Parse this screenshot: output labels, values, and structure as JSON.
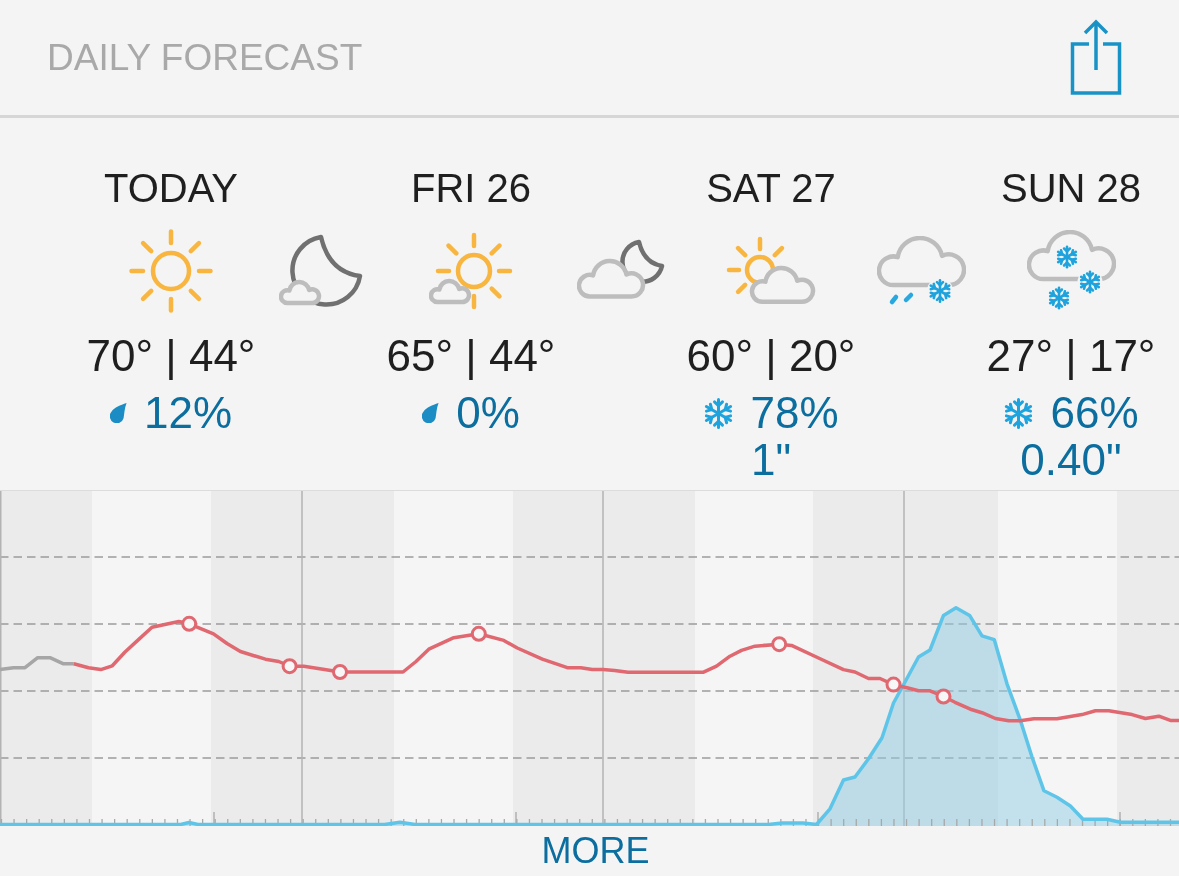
{
  "header": {
    "title": "DAILY FORECAST"
  },
  "periods": [
    {
      "kind": "day",
      "label": "TODAY",
      "icon": {
        "kind": "sunny"
      },
      "temps": "70° | 44°",
      "precip": {
        "kind": "rain",
        "chance": "12%"
      }
    },
    {
      "kind": "night",
      "icon": {
        "kind": "night-moon-cloud"
      }
    },
    {
      "kind": "day",
      "label": "FRI 26",
      "icon": {
        "kind": "partly-sunny"
      },
      "temps": "65° | 44°",
      "precip": {
        "kind": "rain",
        "chance": "0%"
      }
    },
    {
      "kind": "night",
      "icon": {
        "kind": "night-partly-cloudy"
      }
    },
    {
      "kind": "day",
      "label": "SAT 27",
      "icon": {
        "kind": "partly-cloudy"
      },
      "temps": "60° | 20°",
      "precip": {
        "kind": "snow",
        "chance": "78%",
        "amount": "1\""
      }
    },
    {
      "kind": "night",
      "icon": {
        "kind": "rain-snow"
      }
    },
    {
      "kind": "day",
      "label": "SUN 28",
      "icon": {
        "kind": "snow"
      },
      "temps": "27° | 17°",
      "precip": {
        "kind": "snow",
        "chance": "66%",
        "amount": "0.40\""
      }
    }
  ],
  "more_button": {
    "label": "MORE"
  }
}
